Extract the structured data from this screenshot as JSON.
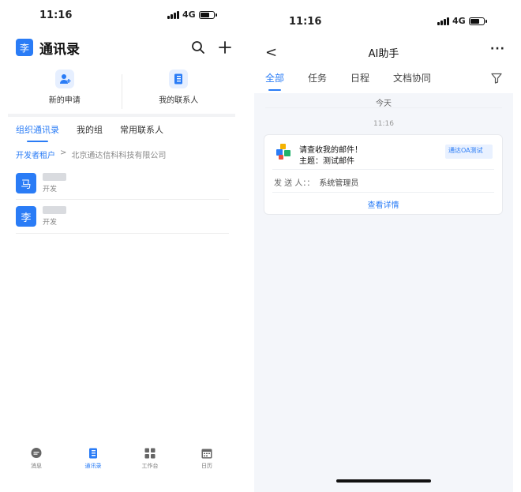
{
  "left": {
    "status": {
      "time": "11:16",
      "network": "4G"
    },
    "header": {
      "avatar_char": "李",
      "title": "通讯录"
    },
    "quick": [
      {
        "label": "新的申请"
      },
      {
        "label": "我的联系人"
      }
    ],
    "tabs": [
      {
        "label": "组织通讯录"
      },
      {
        "label": "我的组"
      },
      {
        "label": "常用联系人"
      }
    ],
    "breadcrumb": {
      "root": "开发者租户",
      "sep": ">",
      "current": "北京通达信科科技有限公司"
    },
    "contacts": [
      {
        "avatar": "马",
        "role": "开发"
      },
      {
        "avatar": "李",
        "role": "开发"
      }
    ],
    "bottom_nav": [
      {
        "label": "消息",
        "icon": "chat-icon"
      },
      {
        "label": "通讯录",
        "icon": "contacts-book-icon"
      },
      {
        "label": "工作台",
        "icon": "grid-icon"
      },
      {
        "label": "日历",
        "icon": "calendar-icon"
      }
    ]
  },
  "right": {
    "status": {
      "time": "11:16",
      "network": "4G"
    },
    "header": {
      "back": "<",
      "title": "AI助手",
      "more": "···"
    },
    "tabs": [
      {
        "label": "全部"
      },
      {
        "label": "任务"
      },
      {
        "label": "日程"
      },
      {
        "label": "文档协同"
      }
    ],
    "day_label": "今天",
    "timestamp": "11:16",
    "card": {
      "line1": "请查收我的邮件！",
      "line2": "主题：测试邮件",
      "tag": "通达OA测试",
      "sender_label": "发 送 人：：",
      "sender_value": "系统管理员",
      "detail": "查看详情"
    }
  },
  "colors": {
    "accent": "#2a7cf6"
  }
}
